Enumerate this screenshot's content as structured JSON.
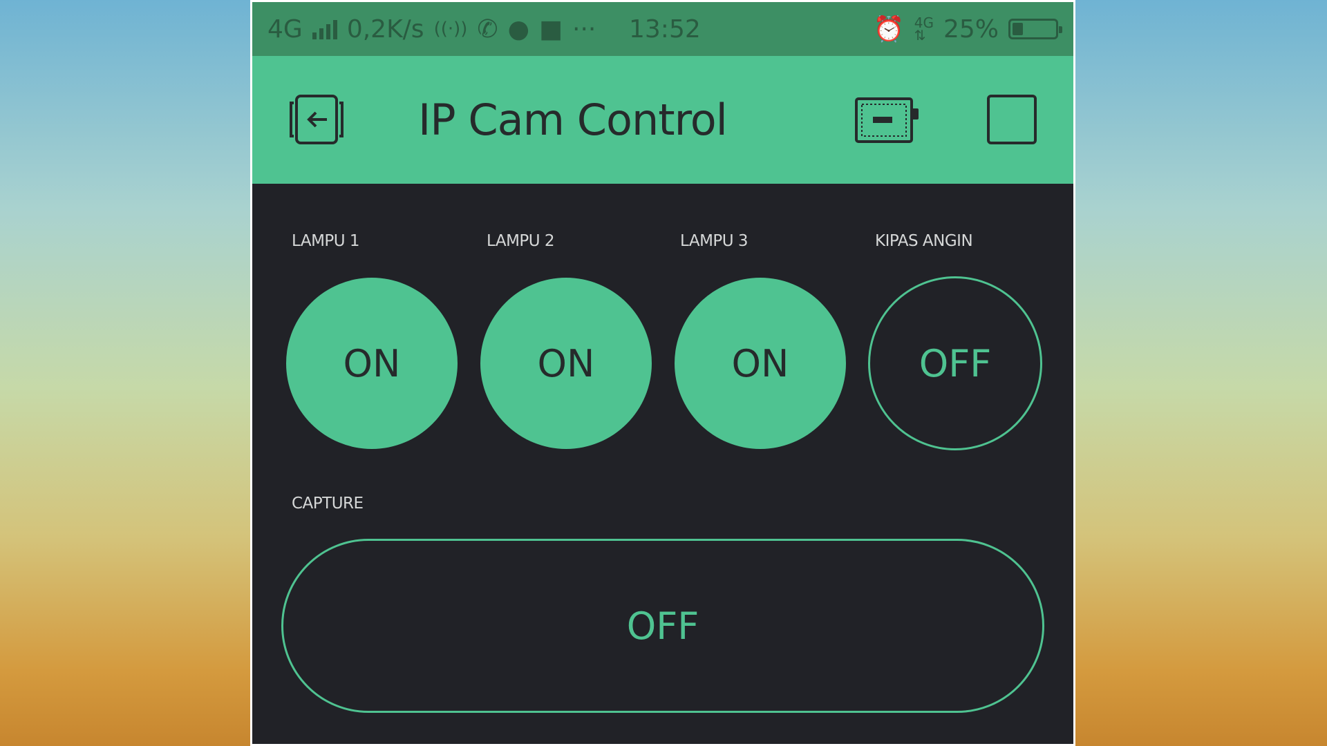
{
  "status_bar": {
    "network": "4G",
    "speed": "0,2K/s",
    "more": "···",
    "time": "13:52",
    "battery_percent": "25%",
    "battery_level": 0.25
  },
  "app_bar": {
    "title": "IP Cam Control"
  },
  "switches": [
    {
      "label": "LAMPU 1",
      "state": "ON"
    },
    {
      "label": "LAMPU 2",
      "state": "ON"
    },
    {
      "label": "LAMPU 3",
      "state": "ON"
    },
    {
      "label": "KIPAS ANGIN",
      "state": "OFF"
    }
  ],
  "capture": {
    "label": "CAPTURE",
    "state": "OFF"
  },
  "colors": {
    "accent": "#4fc391",
    "background": "#212227",
    "status_bar": "#3d8f64",
    "text_dark": "#262a2b"
  }
}
